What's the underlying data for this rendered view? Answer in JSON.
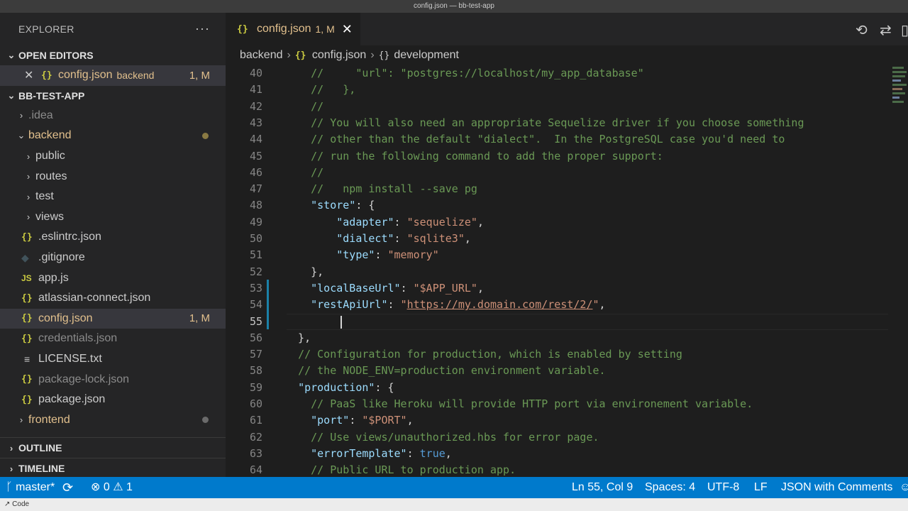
{
  "window": {
    "title": "config.json — bb-test-app"
  },
  "sidebar": {
    "header": "EXPLORER",
    "open_editors": {
      "title": "OPEN EDITORS",
      "item": {
        "name": "config.json",
        "folder": "backend",
        "badge": "1, M"
      }
    },
    "project": {
      "title": "BB-TEST-APP",
      "items": [
        {
          "label": ".idea",
          "kind": "folder"
        },
        {
          "label": "backend",
          "kind": "folder-open"
        },
        {
          "label": "public",
          "kind": "folder"
        },
        {
          "label": "routes",
          "kind": "folder"
        },
        {
          "label": "test",
          "kind": "folder"
        },
        {
          "label": "views",
          "kind": "folder"
        },
        {
          "label": ".eslintrc.json",
          "kind": "json"
        },
        {
          "label": ".gitignore",
          "kind": "git"
        },
        {
          "label": "app.js",
          "kind": "js"
        },
        {
          "label": "atlassian-connect.json",
          "kind": "json"
        },
        {
          "label": "config.json",
          "kind": "json",
          "badge": "1, M"
        },
        {
          "label": "credentials.json",
          "kind": "json"
        },
        {
          "label": "LICENSE.txt",
          "kind": "txt"
        },
        {
          "label": "package-lock.json",
          "kind": "json"
        },
        {
          "label": "package.json",
          "kind": "json"
        },
        {
          "label": "frontend",
          "kind": "folder"
        }
      ]
    },
    "outline": "OUTLINE",
    "timeline": "TIMELINE"
  },
  "tab": {
    "name": "config.json",
    "badge": "1, M"
  },
  "breadcrumbs": [
    "backend",
    "config.json",
    "development"
  ],
  "editor": {
    "lines": [
      {
        "n": "40",
        "text": "    //     \"url\": \"postgres://localhost/my_app_database\""
      },
      {
        "n": "41",
        "text": "    //   },"
      },
      {
        "n": "42",
        "text": "    //"
      },
      {
        "n": "43",
        "text": "    // You will also need an appropriate Sequelize driver if you choose something"
      },
      {
        "n": "44",
        "text": "    // other than the default \"dialect\".  In the PostgreSQL case you'd need to"
      },
      {
        "n": "45",
        "text": "    // run the following command to add the proper support:"
      },
      {
        "n": "46",
        "text": "    //"
      },
      {
        "n": "47",
        "text": "    //   npm install --save pg"
      },
      {
        "n": "48",
        "key": "\"store\"",
        "rest": ": {"
      },
      {
        "n": "49",
        "key": "\"adapter\"",
        "rest": ": ",
        "value": "\"sequelize\"",
        "tail": ","
      },
      {
        "n": "50",
        "key": "\"dialect\"",
        "rest": ": ",
        "value": "\"sqlite3\"",
        "tail": ","
      },
      {
        "n": "51",
        "key": "\"type\"",
        "rest": ": ",
        "value": "\"memory\""
      },
      {
        "n": "52",
        "text": "    },"
      },
      {
        "n": "53",
        "key": "\"localBaseUrl\"",
        "rest": ": ",
        "value": "\"$APP_URL\"",
        "tail": ","
      },
      {
        "n": "54",
        "key": "\"restApiUrl\"",
        "rest": ": ",
        "value_q": "\"",
        "link": "https://my.domain.com/rest/2/",
        "value_q2": "\"",
        "tail": ","
      },
      {
        "n": "55",
        "text": ""
      },
      {
        "n": "56",
        "text": "  },"
      },
      {
        "n": "57",
        "text": "  // Configuration for production, which is enabled by setting"
      },
      {
        "n": "58",
        "text": "  // the NODE_ENV=production environment variable."
      },
      {
        "n": "59",
        "key": "\"production\"",
        "rest": ": {"
      },
      {
        "n": "60",
        "text": "    // PaaS like Heroku will provide HTTP port via environement variable."
      },
      {
        "n": "61",
        "key": "\"port\"",
        "rest": ": ",
        "value": "\"$PORT\"",
        "tail": ","
      },
      {
        "n": "62",
        "text": "    // Use views/unauthorized.hbs for error page."
      },
      {
        "n": "63",
        "key": "\"errorTemplate\"",
        "rest": ": ",
        "kw": "true",
        "tail": ","
      },
      {
        "n": "64",
        "text": "    // Public URL to production app."
      }
    ]
  },
  "status": {
    "branch": "master*",
    "errors": "0",
    "warnings": "1",
    "position": "Ln 55, Col 9",
    "spaces": "Spaces: 4",
    "encoding": "UTF-8",
    "eol": "LF",
    "language": "JSON with Comments"
  },
  "bottom": {
    "label": "Code"
  },
  "colors": {
    "accent": "#007acc",
    "modified": "#e2c08d"
  }
}
